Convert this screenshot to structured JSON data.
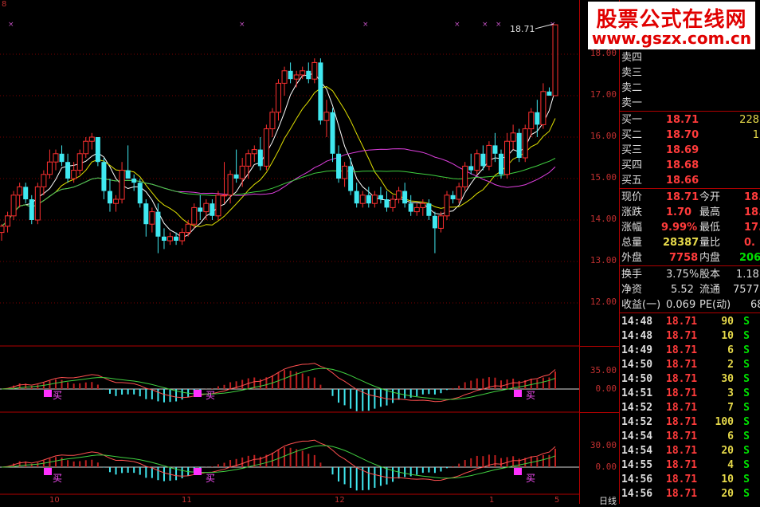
{
  "watermark": {
    "line1": "股票公式在线网",
    "line2": "www.gszx.com.cn"
  },
  "main_chart": {
    "price_axis": [
      "18.00",
      "17.00",
      "16.00",
      "15.00",
      "14.00",
      "13.00",
      "12.00"
    ],
    "last_price_label": "18.71",
    "corner_left": "8",
    "bottom_ticks": [
      "10",
      "11",
      "12",
      "1",
      "5"
    ],
    "bottom_right_label": "日线"
  },
  "macd1": {
    "axis": [
      "35.00",
      "0.00"
    ],
    "buy_labels": [
      "买",
      "买",
      "买"
    ]
  },
  "macd2": {
    "axis": [
      "30.00",
      "0.00"
    ],
    "buy_labels": [
      "买",
      "买",
      "买"
    ]
  },
  "order_book": {
    "sells": [
      {
        "label": "卖四"
      },
      {
        "label": "卖三"
      },
      {
        "label": "卖二"
      },
      {
        "label": "卖一"
      }
    ],
    "buys": [
      {
        "label": "买一",
        "price": "18.71",
        "vol": "228"
      },
      {
        "label": "买二",
        "price": "18.70",
        "vol": "1"
      },
      {
        "label": "买三",
        "price": "18.69",
        "vol": ""
      },
      {
        "label": "买四",
        "price": "18.68",
        "vol": ""
      },
      {
        "label": "买五",
        "price": "18.66",
        "vol": ""
      }
    ]
  },
  "quote": {
    "rows": [
      {
        "l1": "现价",
        "v1": "18.71",
        "l2": "今开",
        "v2": "18."
      },
      {
        "l1": "涨跌",
        "v1": "1.70",
        "l2": "最高",
        "v2": "18."
      },
      {
        "l1": "涨幅",
        "v1": "9.99%",
        "l2": "最低",
        "v2": "17."
      },
      {
        "l1": "总量",
        "v1": "28387",
        "l2": "量比",
        "v2": "0."
      },
      {
        "l1": "外盘",
        "v1": "7758",
        "l2": "内盘",
        "v2": "206"
      }
    ],
    "stats": [
      {
        "l1": "换手",
        "v1": "3.75%",
        "l2": "股本",
        "v2": "1.18"
      },
      {
        "l1": "净资",
        "v1": "5.52",
        "l2": "流通",
        "v2": "7577"
      },
      {
        "l1": "收益(一)",
        "v1": "0.069",
        "l2": "PE(动)",
        "v2": "68"
      }
    ]
  },
  "trades": [
    {
      "time": "14:48",
      "price": "18.71",
      "vol": "90",
      "side": "S"
    },
    {
      "time": "14:48",
      "price": "18.71",
      "vol": "10",
      "side": "S"
    },
    {
      "time": "14:49",
      "price": "18.71",
      "vol": "6",
      "side": "S"
    },
    {
      "time": "14:50",
      "price": "18.71",
      "vol": "2",
      "side": "S"
    },
    {
      "time": "14:50",
      "price": "18.71",
      "vol": "30",
      "side": "S"
    },
    {
      "time": "14:51",
      "price": "18.71",
      "vol": "3",
      "side": "S"
    },
    {
      "time": "14:52",
      "price": "18.71",
      "vol": "7",
      "side": "S"
    },
    {
      "time": "14:52",
      "price": "18.71",
      "vol": "100",
      "side": "S"
    },
    {
      "time": "14:54",
      "price": "18.71",
      "vol": "6",
      "side": "S"
    },
    {
      "time": "14:54",
      "price": "18.71",
      "vol": "20",
      "side": "S"
    },
    {
      "time": "14:55",
      "price": "18.71",
      "vol": "4",
      "side": "S"
    },
    {
      "time": "14:56",
      "price": "18.71",
      "vol": "10",
      "side": "S"
    },
    {
      "time": "14:56",
      "price": "18.71",
      "vol": "20",
      "side": "S"
    }
  ],
  "chart_data": {
    "type": "candlestick",
    "y_range": [
      12,
      18.4
    ],
    "candles": [
      [
        13.7,
        13.9,
        13.5,
        13.85
      ],
      [
        13.85,
        14.2,
        13.7,
        14.1
      ],
      [
        14.1,
        14.7,
        14.0,
        14.6
      ],
      [
        14.6,
        14.9,
        14.3,
        14.8
      ],
      [
        14.8,
        14.9,
        14.4,
        14.5
      ],
      [
        14.5,
        14.6,
        13.9,
        14.0
      ],
      [
        14.0,
        14.9,
        13.9,
        14.8
      ],
      [
        14.8,
        15.2,
        14.6,
        15.1
      ],
      [
        15.1,
        15.7,
        15.0,
        15.4
      ],
      [
        15.4,
        15.7,
        15.2,
        15.6
      ],
      [
        15.6,
        15.8,
        15.3,
        15.4
      ],
      [
        15.4,
        15.6,
        14.9,
        15.0
      ],
      [
        15.0,
        15.4,
        14.9,
        15.2
      ],
      [
        15.2,
        15.7,
        15.1,
        15.6
      ],
      [
        15.6,
        16.0,
        15.5,
        15.9
      ],
      [
        15.9,
        16.1,
        15.7,
        16.0
      ],
      [
        16.0,
        16.0,
        15.3,
        15.4
      ],
      [
        15.4,
        15.5,
        14.5,
        14.7
      ],
      [
        14.7,
        15.0,
        14.2,
        14.4
      ],
      [
        14.4,
        14.6,
        14.2,
        14.5
      ],
      [
        14.5,
        15.4,
        14.4,
        15.2
      ],
      [
        15.2,
        15.8,
        15.0,
        15.0
      ],
      [
        15.0,
        15.1,
        14.7,
        14.9
      ],
      [
        14.9,
        15.0,
        14.3,
        14.4
      ],
      [
        14.4,
        14.5,
        13.6,
        13.9
      ],
      [
        13.9,
        14.3,
        13.7,
        14.2
      ],
      [
        14.2,
        14.4,
        13.2,
        13.6
      ],
      [
        13.6,
        13.8,
        13.3,
        13.5
      ],
      [
        13.5,
        13.7,
        13.4,
        13.6
      ],
      [
        13.6,
        13.7,
        13.4,
        13.5
      ],
      [
        13.5,
        13.8,
        13.4,
        13.7
      ],
      [
        13.7,
        14.0,
        13.6,
        13.9
      ],
      [
        13.9,
        14.4,
        13.8,
        14.3
      ],
      [
        14.3,
        14.6,
        14.0,
        14.2
      ],
      [
        14.2,
        14.5,
        14.0,
        14.4
      ],
      [
        14.4,
        14.5,
        14.0,
        14.1
      ],
      [
        14.1,
        14.7,
        14.0,
        14.6
      ],
      [
        14.6,
        15.4,
        14.4,
        14.6
      ],
      [
        14.6,
        15.2,
        14.4,
        15.1
      ],
      [
        15.1,
        15.7,
        14.9,
        15.0
      ],
      [
        15.0,
        15.5,
        14.8,
        15.3
      ],
      [
        15.3,
        15.7,
        15.0,
        15.6
      ],
      [
        15.6,
        15.8,
        15.4,
        15.7
      ],
      [
        15.7,
        16.0,
        15.2,
        15.3
      ],
      [
        15.3,
        16.3,
        15.2,
        16.2
      ],
      [
        16.2,
        16.7,
        16.0,
        16.6
      ],
      [
        16.6,
        17.4,
        16.4,
        17.3
      ],
      [
        17.3,
        17.7,
        17.0,
        17.6
      ],
      [
        17.6,
        17.8,
        17.3,
        17.4
      ],
      [
        17.4,
        17.6,
        17.2,
        17.5
      ],
      [
        17.5,
        17.7,
        17.4,
        17.6
      ],
      [
        17.6,
        17.8,
        17.3,
        17.4
      ],
      [
        17.4,
        17.9,
        17.3,
        17.8
      ],
      [
        17.8,
        17.9,
        16.3,
        16.4
      ],
      [
        16.4,
        16.9,
        16.0,
        16.6
      ],
      [
        16.6,
        16.7,
        15.4,
        15.6
      ],
      [
        15.6,
        15.8,
        14.9,
        15.0
      ],
      [
        15.0,
        15.4,
        14.8,
        15.3
      ],
      [
        15.3,
        15.5,
        14.6,
        14.7
      ],
      [
        14.7,
        14.9,
        14.3,
        14.4
      ],
      [
        14.4,
        14.7,
        14.3,
        14.6
      ],
      [
        14.6,
        14.8,
        14.3,
        14.4
      ],
      [
        14.4,
        14.7,
        14.3,
        14.6
      ],
      [
        14.6,
        14.8,
        14.4,
        14.5
      ],
      [
        14.5,
        14.7,
        14.2,
        14.3
      ],
      [
        14.3,
        14.6,
        14.2,
        14.5
      ],
      [
        14.5,
        14.8,
        14.4,
        14.7
      ],
      [
        14.7,
        14.9,
        14.3,
        14.4
      ],
      [
        14.4,
        14.6,
        14.1,
        14.2
      ],
      [
        14.2,
        14.4,
        14.1,
        14.3
      ],
      [
        14.3,
        14.5,
        14.1,
        14.4
      ],
      [
        14.4,
        14.5,
        14.0,
        14.1
      ],
      [
        14.1,
        14.2,
        13.2,
        13.8
      ],
      [
        13.8,
        14.2,
        13.7,
        14.1
      ],
      [
        14.1,
        14.7,
        14.0,
        14.6
      ],
      [
        14.6,
        14.7,
        14.4,
        14.5
      ],
      [
        14.5,
        14.9,
        14.4,
        14.8
      ],
      [
        14.8,
        15.4,
        14.7,
        15.3
      ],
      [
        15.3,
        15.6,
        15.1,
        15.2
      ],
      [
        15.2,
        15.7,
        15.1,
        15.6
      ],
      [
        15.6,
        15.8,
        15.2,
        15.3
      ],
      [
        15.3,
        15.9,
        15.2,
        15.8
      ],
      [
        15.8,
        16.1,
        15.4,
        15.6
      ],
      [
        15.6,
        15.7,
        15.0,
        15.1
      ],
      [
        15.1,
        16.1,
        15.0,
        15.9
      ],
      [
        15.9,
        16.3,
        15.7,
        16.1
      ],
      [
        16.1,
        16.2,
        15.4,
        15.5
      ],
      [
        15.5,
        16.3,
        15.4,
        16.2
      ],
      [
        16.2,
        16.7,
        16.0,
        16.6
      ],
      [
        16.6,
        16.9,
        16.0,
        16.3
      ],
      [
        16.3,
        17.3,
        16.2,
        17.1
      ],
      [
        17.1,
        17.2,
        17.0,
        17.0
      ],
      [
        17.0,
        18.71,
        17.5,
        18.71
      ]
    ]
  }
}
